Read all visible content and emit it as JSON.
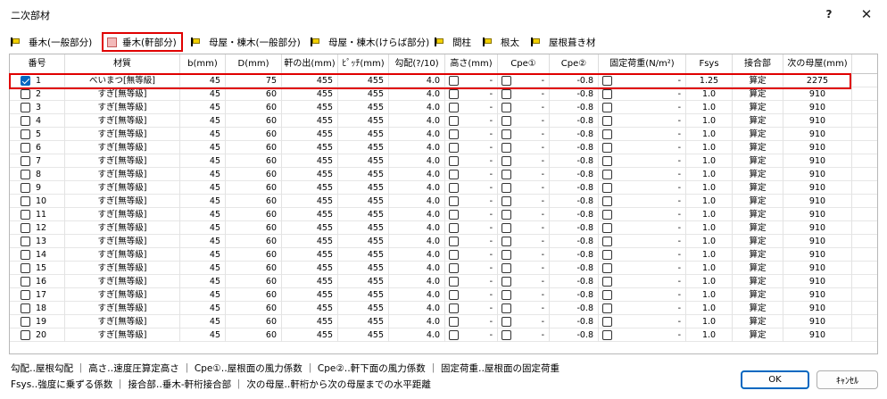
{
  "window": {
    "title": "二次部材",
    "help_label": "?",
    "close_label": "✕"
  },
  "tabs": [
    {
      "label": "垂木(一般部分)",
      "active": false
    },
    {
      "label": "垂木(軒部分)",
      "active": true
    },
    {
      "label": "母屋・棟木(一般部分)",
      "active": false
    },
    {
      "label": "母屋・棟木(けらば部分)",
      "active": false
    },
    {
      "label": "間柱",
      "active": false
    },
    {
      "label": "根太",
      "active": false
    },
    {
      "label": "屋根葺き材",
      "active": false
    }
  ],
  "table": {
    "headers": [
      "番号",
      "材質",
      "b(mm)",
      "D(mm)",
      "軒の出(mm)",
      "ﾋﾟｯﾁ(mm)",
      "勾配(?/10)",
      "高さ(mm)",
      "Cpe①",
      "Cpe②",
      "固定荷重(N/m²)",
      "Fsys",
      "接合部",
      "次の母屋(mm)"
    ],
    "rows": [
      {
        "no": "1",
        "checked": true,
        "material": "べいまつ[無等級]",
        "b": "45",
        "d": "75",
        "eave": "455",
        "pitch": "455",
        "slope": "4.0",
        "height": "-",
        "cpe1": "-",
        "cpe2": "-0.8",
        "load": "-",
        "fsys": "1.25",
        "joint": "算定",
        "next": "2275"
      },
      {
        "no": "2",
        "checked": false,
        "material": "すぎ[無等級]",
        "b": "45",
        "d": "60",
        "eave": "455",
        "pitch": "455",
        "slope": "4.0",
        "height": "-",
        "cpe1": "-",
        "cpe2": "-0.8",
        "load": "-",
        "fsys": "1.0",
        "joint": "算定",
        "next": "910"
      },
      {
        "no": "3",
        "checked": false,
        "material": "すぎ[無等級]",
        "b": "45",
        "d": "60",
        "eave": "455",
        "pitch": "455",
        "slope": "4.0",
        "height": "-",
        "cpe1": "-",
        "cpe2": "-0.8",
        "load": "-",
        "fsys": "1.0",
        "joint": "算定",
        "next": "910"
      },
      {
        "no": "4",
        "checked": false,
        "material": "すぎ[無等級]",
        "b": "45",
        "d": "60",
        "eave": "455",
        "pitch": "455",
        "slope": "4.0",
        "height": "-",
        "cpe1": "-",
        "cpe2": "-0.8",
        "load": "-",
        "fsys": "1.0",
        "joint": "算定",
        "next": "910"
      },
      {
        "no": "5",
        "checked": false,
        "material": "すぎ[無等級]",
        "b": "45",
        "d": "60",
        "eave": "455",
        "pitch": "455",
        "slope": "4.0",
        "height": "-",
        "cpe1": "-",
        "cpe2": "-0.8",
        "load": "-",
        "fsys": "1.0",
        "joint": "算定",
        "next": "910"
      },
      {
        "no": "6",
        "checked": false,
        "material": "すぎ[無等級]",
        "b": "45",
        "d": "60",
        "eave": "455",
        "pitch": "455",
        "slope": "4.0",
        "height": "-",
        "cpe1": "-",
        "cpe2": "-0.8",
        "load": "-",
        "fsys": "1.0",
        "joint": "算定",
        "next": "910"
      },
      {
        "no": "7",
        "checked": false,
        "material": "すぎ[無等級]",
        "b": "45",
        "d": "60",
        "eave": "455",
        "pitch": "455",
        "slope": "4.0",
        "height": "-",
        "cpe1": "-",
        "cpe2": "-0.8",
        "load": "-",
        "fsys": "1.0",
        "joint": "算定",
        "next": "910"
      },
      {
        "no": "8",
        "checked": false,
        "material": "すぎ[無等級]",
        "b": "45",
        "d": "60",
        "eave": "455",
        "pitch": "455",
        "slope": "4.0",
        "height": "-",
        "cpe1": "-",
        "cpe2": "-0.8",
        "load": "-",
        "fsys": "1.0",
        "joint": "算定",
        "next": "910"
      },
      {
        "no": "9",
        "checked": false,
        "material": "すぎ[無等級]",
        "b": "45",
        "d": "60",
        "eave": "455",
        "pitch": "455",
        "slope": "4.0",
        "height": "-",
        "cpe1": "-",
        "cpe2": "-0.8",
        "load": "-",
        "fsys": "1.0",
        "joint": "算定",
        "next": "910"
      },
      {
        "no": "10",
        "checked": false,
        "material": "すぎ[無等級]",
        "b": "45",
        "d": "60",
        "eave": "455",
        "pitch": "455",
        "slope": "4.0",
        "height": "-",
        "cpe1": "-",
        "cpe2": "-0.8",
        "load": "-",
        "fsys": "1.0",
        "joint": "算定",
        "next": "910"
      },
      {
        "no": "11",
        "checked": false,
        "material": "すぎ[無等級]",
        "b": "45",
        "d": "60",
        "eave": "455",
        "pitch": "455",
        "slope": "4.0",
        "height": "-",
        "cpe1": "-",
        "cpe2": "-0.8",
        "load": "-",
        "fsys": "1.0",
        "joint": "算定",
        "next": "910"
      },
      {
        "no": "12",
        "checked": false,
        "material": "すぎ[無等級]",
        "b": "45",
        "d": "60",
        "eave": "455",
        "pitch": "455",
        "slope": "4.0",
        "height": "-",
        "cpe1": "-",
        "cpe2": "-0.8",
        "load": "-",
        "fsys": "1.0",
        "joint": "算定",
        "next": "910"
      },
      {
        "no": "13",
        "checked": false,
        "material": "すぎ[無等級]",
        "b": "45",
        "d": "60",
        "eave": "455",
        "pitch": "455",
        "slope": "4.0",
        "height": "-",
        "cpe1": "-",
        "cpe2": "-0.8",
        "load": "-",
        "fsys": "1.0",
        "joint": "算定",
        "next": "910"
      },
      {
        "no": "14",
        "checked": false,
        "material": "すぎ[無等級]",
        "b": "45",
        "d": "60",
        "eave": "455",
        "pitch": "455",
        "slope": "4.0",
        "height": "-",
        "cpe1": "-",
        "cpe2": "-0.8",
        "load": "-",
        "fsys": "1.0",
        "joint": "算定",
        "next": "910"
      },
      {
        "no": "15",
        "checked": false,
        "material": "すぎ[無等級]",
        "b": "45",
        "d": "60",
        "eave": "455",
        "pitch": "455",
        "slope": "4.0",
        "height": "-",
        "cpe1": "-",
        "cpe2": "-0.8",
        "load": "-",
        "fsys": "1.0",
        "joint": "算定",
        "next": "910"
      },
      {
        "no": "16",
        "checked": false,
        "material": "すぎ[無等級]",
        "b": "45",
        "d": "60",
        "eave": "455",
        "pitch": "455",
        "slope": "4.0",
        "height": "-",
        "cpe1": "-",
        "cpe2": "-0.8",
        "load": "-",
        "fsys": "1.0",
        "joint": "算定",
        "next": "910"
      },
      {
        "no": "17",
        "checked": false,
        "material": "すぎ[無等級]",
        "b": "45",
        "d": "60",
        "eave": "455",
        "pitch": "455",
        "slope": "4.0",
        "height": "-",
        "cpe1": "-",
        "cpe2": "-0.8",
        "load": "-",
        "fsys": "1.0",
        "joint": "算定",
        "next": "910"
      },
      {
        "no": "18",
        "checked": false,
        "material": "すぎ[無等級]",
        "b": "45",
        "d": "60",
        "eave": "455",
        "pitch": "455",
        "slope": "4.0",
        "height": "-",
        "cpe1": "-",
        "cpe2": "-0.8",
        "load": "-",
        "fsys": "1.0",
        "joint": "算定",
        "next": "910"
      },
      {
        "no": "19",
        "checked": false,
        "material": "すぎ[無等級]",
        "b": "45",
        "d": "60",
        "eave": "455",
        "pitch": "455",
        "slope": "4.0",
        "height": "-",
        "cpe1": "-",
        "cpe2": "-0.8",
        "load": "-",
        "fsys": "1.0",
        "joint": "算定",
        "next": "910"
      },
      {
        "no": "20",
        "checked": false,
        "material": "すぎ[無等級]",
        "b": "45",
        "d": "60",
        "eave": "455",
        "pitch": "455",
        "slope": "4.0",
        "height": "-",
        "cpe1": "-",
        "cpe2": "-0.8",
        "load": "-",
        "fsys": "1.0",
        "joint": "算定",
        "next": "910"
      }
    ]
  },
  "legend": {
    "line1": "勾配‥屋根勾配 ｜ 高さ‥速度圧算定高さ ｜ Cpe①‥屋根面の風力係数 ｜ Cpe②‥軒下面の風力係数 ｜ 固定荷重‥屋根面の固定荷重",
    "line2": "Fsys‥強度に乗ずる係数 ｜ 接合部‥垂木-軒桁接合部 ｜ 次の母屋‥軒桁から次の母屋までの水平距離"
  },
  "buttons": {
    "ok": "OK",
    "cancel": "ｷｬﾝｾﾙ"
  },
  "colors": {
    "highlight": "#e00000",
    "checkbox_checked": "#0067c0",
    "tab_flag": "#f2d000",
    "active_tab_square": "#f3b9b9"
  }
}
